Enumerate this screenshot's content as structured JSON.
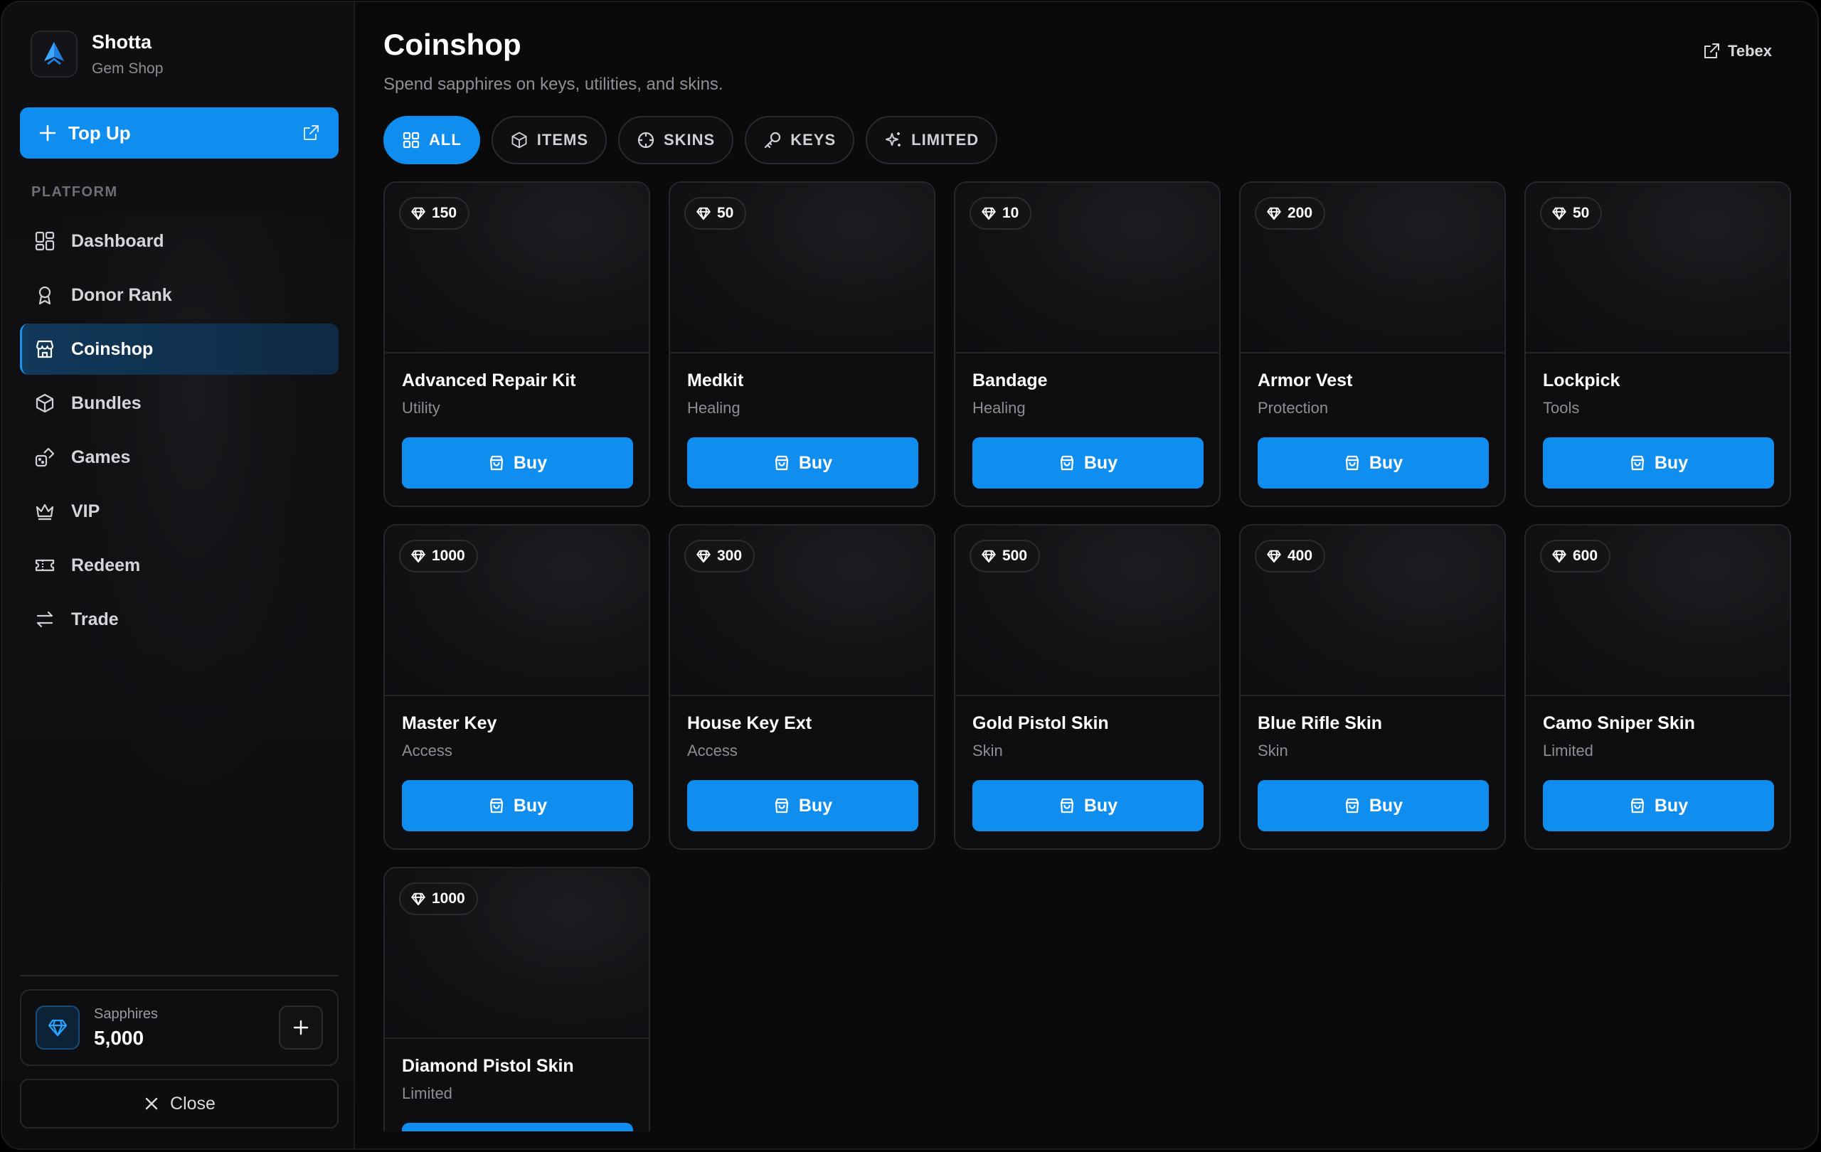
{
  "brand": {
    "name": "Shotta",
    "subtitle": "Gem Shop",
    "icon": "shield-logo-icon"
  },
  "topup": {
    "label": "Top Up"
  },
  "sidebar": {
    "section_label": "PLATFORM",
    "items": [
      {
        "label": "Dashboard",
        "icon": "grid-icon"
      },
      {
        "label": "Donor Rank",
        "icon": "award-icon"
      },
      {
        "label": "Coinshop",
        "icon": "store-icon",
        "active": true
      },
      {
        "label": "Bundles",
        "icon": "package-icon"
      },
      {
        "label": "Games",
        "icon": "dice-icon"
      },
      {
        "label": "VIP",
        "icon": "crown-icon"
      },
      {
        "label": "Redeem",
        "icon": "ticket-icon"
      },
      {
        "label": "Trade",
        "icon": "swap-icon"
      }
    ]
  },
  "wallet": {
    "label": "Sapphires",
    "value": "5,000"
  },
  "close": {
    "label": "Close"
  },
  "header": {
    "title": "Coinshop",
    "subtitle": "Spend sapphires on keys, utilities, and skins.",
    "tebex_label": "Tebex"
  },
  "filters": [
    {
      "label": "ALL",
      "icon": "grid-icon",
      "active": true
    },
    {
      "label": "ITEMS",
      "icon": "package-icon"
    },
    {
      "label": "SKINS",
      "icon": "crosshair-icon"
    },
    {
      "label": "KEYS",
      "icon": "key-icon"
    },
    {
      "label": "LIMITED",
      "icon": "sparkles-icon"
    }
  ],
  "buy_label": "Buy",
  "products": [
    {
      "price": "150",
      "name": "Advanced Repair Kit",
      "category": "Utility"
    },
    {
      "price": "50",
      "name": "Medkit",
      "category": "Healing"
    },
    {
      "price": "10",
      "name": "Bandage",
      "category": "Healing"
    },
    {
      "price": "200",
      "name": "Armor Vest",
      "category": "Protection"
    },
    {
      "price": "50",
      "name": "Lockpick",
      "category": "Tools"
    },
    {
      "price": "1000",
      "name": "Master Key",
      "category": "Access"
    },
    {
      "price": "300",
      "name": "House Key Ext",
      "category": "Access"
    },
    {
      "price": "500",
      "name": "Gold Pistol Skin",
      "category": "Skin"
    },
    {
      "price": "400",
      "name": "Blue Rifle Skin",
      "category": "Skin"
    },
    {
      "price": "600",
      "name": "Camo Sniper Skin",
      "category": "Limited"
    },
    {
      "price": "1000",
      "name": "Diamond Pistol Skin",
      "category": "Limited"
    }
  ],
  "colors": {
    "accent": "#0f8ef0",
    "background": "#0a0a0b",
    "card": "#0e0e11"
  }
}
